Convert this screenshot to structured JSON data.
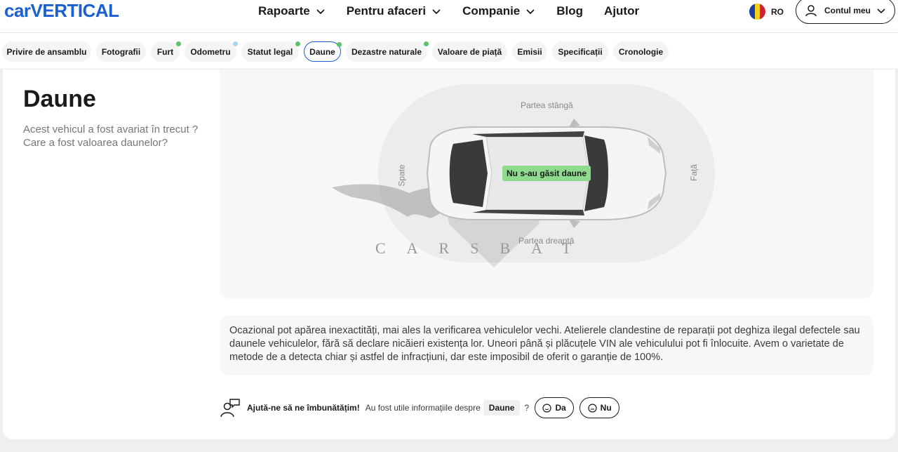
{
  "brand": {
    "logo_text": "carVERTICAL",
    "color": "#1b5fd1"
  },
  "nav": {
    "items": [
      {
        "label": "Rapoarte",
        "has_dropdown": true
      },
      {
        "label": "Pentru afaceri",
        "has_dropdown": true
      },
      {
        "label": "Companie",
        "has_dropdown": true
      },
      {
        "label": "Blog",
        "has_dropdown": false
      },
      {
        "label": "Ajutor",
        "has_dropdown": false
      }
    ]
  },
  "language": {
    "code": "RO",
    "flag_icon": "romania-flag-icon"
  },
  "account": {
    "label": "Contul meu",
    "icon": "user-icon"
  },
  "tabs": [
    {
      "label": "Privire de ansamblu",
      "active": false,
      "indicator": "none"
    },
    {
      "label": "Fotografii",
      "active": false,
      "indicator": "none"
    },
    {
      "label": "Furt",
      "active": false,
      "indicator": "green"
    },
    {
      "label": "Odometru",
      "active": false,
      "indicator": "blue"
    },
    {
      "label": "Statut legal",
      "active": false,
      "indicator": "green"
    },
    {
      "label": "Daune",
      "active": true,
      "indicator": "green"
    },
    {
      "label": "Dezastre naturale",
      "active": false,
      "indicator": "green"
    },
    {
      "label": "Valoare de piață",
      "active": false,
      "indicator": "none"
    },
    {
      "label": "Emisii",
      "active": false,
      "indicator": "none"
    },
    {
      "label": "Specificații",
      "active": false,
      "indicator": "none"
    },
    {
      "label": "Cronologie",
      "active": false,
      "indicator": "none"
    }
  ],
  "section": {
    "title": "Daune",
    "subtitle": "Acest vehicul a fost avariat în trecut ? Care a fost valoarea daunelor?"
  },
  "diagram": {
    "badge": "Nu s-au găsit daune",
    "label_left_side": "Partea stângă",
    "label_right_side": "Partea dreaptă",
    "label_rear": "Spate",
    "label_front": "Față",
    "watermark": "CARSBAT",
    "badge_color": "#8edb8e"
  },
  "note": {
    "text": "Ocazional pot apărea inexactități, mai ales la verificarea vehiculelor vechi. Atelierele clandestine de reparații pot deghiza ilegal defectele sau daunele vehiculelor, fără să declare nicăieri existența lor. Uneori până și plăcuțele VIN ale vehiculului pot fi înlocuite. Avem o varietate de metode de a detecta chiar și astfel de infracțiuni, dar este imposibil de oferit o garanție de 100%."
  },
  "feedback": {
    "prompt_bold": "Ajută-ne să ne îmbunătățim!",
    "question": "Au fost utile informațiile despre",
    "topic": "Daune",
    "question_mark": "?",
    "yes_label": "Da",
    "no_label": "Nu"
  }
}
